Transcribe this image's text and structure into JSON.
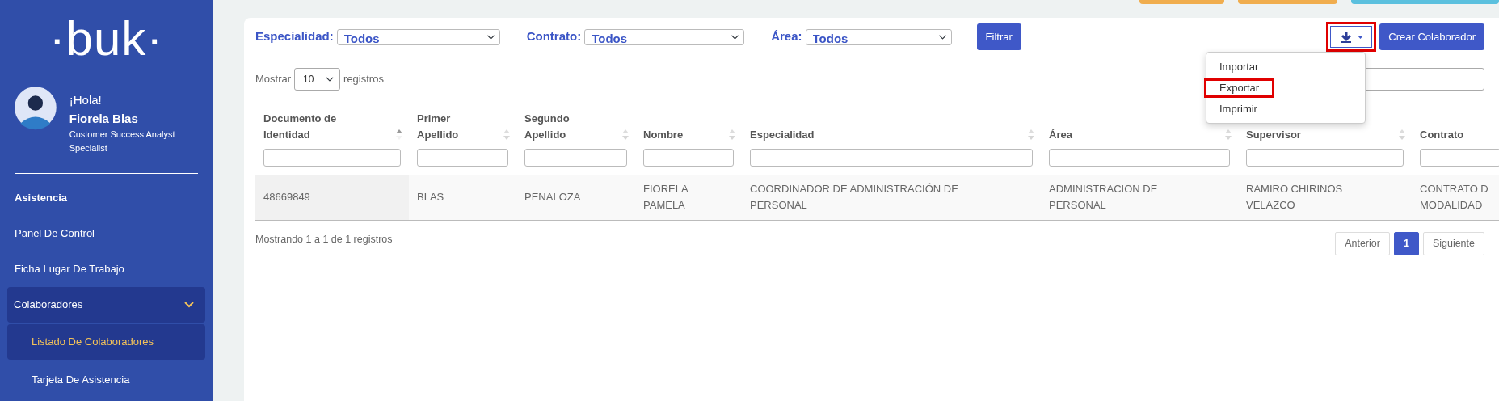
{
  "sidebar": {
    "logo": "·buk·",
    "user": {
      "greeting": "¡Hola!",
      "name": "Fiorela Blas",
      "role": "Customer Success Analyst Specialist"
    },
    "section": "Asistencia",
    "items": [
      {
        "label": "Panel De Control",
        "selected": false
      },
      {
        "label": "Ficha Lugar De Trabajo",
        "selected": false
      },
      {
        "label": "Colaboradores",
        "selected": false,
        "expanded": true,
        "children": [
          {
            "label": "Listado De Colaboradores",
            "selected": true
          },
          {
            "label": "Tarjeta De Asistencia",
            "selected": false
          }
        ]
      }
    ]
  },
  "top_buttons": [
    {
      "color": "#f0ad4e"
    },
    {
      "color": "#f0ad4e"
    },
    {
      "color": "#5bc0de"
    }
  ],
  "filters": [
    {
      "label": "Especialidad:",
      "value": "Todos"
    },
    {
      "label": "Contrato:",
      "value": "Todos"
    },
    {
      "label": "Área:",
      "value": "Todos"
    }
  ],
  "filter_button": "Filtrar",
  "export_menu": {
    "expanded": true,
    "highlighted": true,
    "items": [
      {
        "label": "Importar",
        "highlighted": false
      },
      {
        "label": "Exportar",
        "highlighted": true
      },
      {
        "label": "Imprimir",
        "highlighted": false
      }
    ]
  },
  "create_button": "Crear Colaborador",
  "length": {
    "prefix": "Mostrar",
    "value": "10",
    "suffix": "registros"
  },
  "table": {
    "columns": [
      {
        "label": "Documento de Identidad",
        "sorted": true
      },
      {
        "label": "Primer Apellido",
        "sorted": false
      },
      {
        "label": "Segundo Apellido",
        "sorted": false
      },
      {
        "label": "Nombre",
        "sorted": false
      },
      {
        "label": "Especialidad",
        "sorted": false
      },
      {
        "label": "Área",
        "sorted": false
      },
      {
        "label": "Supervisor",
        "sorted": false
      },
      {
        "label": "Contrato"
      }
    ],
    "rows": [
      [
        "48669849",
        "BLAS",
        "PEÑALOZA",
        "FIORELA PAMELA",
        "COORDINADOR DE ADMINISTRACIÓN DE PERSONAL",
        "ADMINISTRACION DE PERSONAL",
        "RAMIRO CHIRINOS VELAZCO",
        "CONTRATO D MODALIDAD"
      ]
    ]
  },
  "footer": {
    "info": "Mostrando 1 a 1 de 1 registros",
    "pages": [
      {
        "label": "Anterior",
        "selected": false
      },
      {
        "label": "1",
        "selected": true
      },
      {
        "label": "Siguiente",
        "selected": false
      }
    ]
  }
}
